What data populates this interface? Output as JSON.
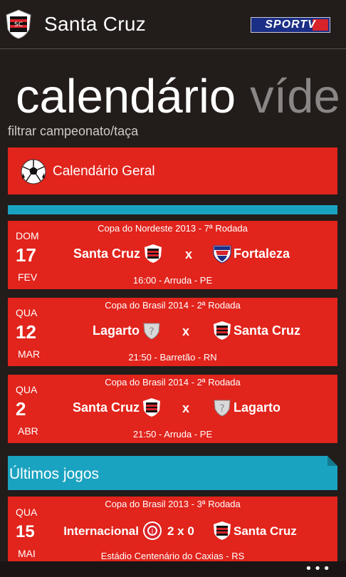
{
  "header": {
    "title": "Santa Cruz",
    "partner_logo_text": "SPORTV"
  },
  "pivot": {
    "active": "calendário",
    "next": "víde"
  },
  "filter_label": "filtrar campeonato/taça",
  "calendar_all": {
    "label": "Calendário Geral",
    "icon": "soccer-ball-icon"
  },
  "upcoming": [
    {
      "competition": "Copa do Nordeste 2013 - 7ª Rodada",
      "weekday": "DOM",
      "day": "17",
      "month": "FEV",
      "home": "Santa Cruz",
      "vs": "x",
      "away": "Fortaleza",
      "venue": "16:00 - Arruda - PE"
    },
    {
      "competition": "Copa do Brasil 2014 - 2ª Rodada",
      "weekday": "QUA",
      "day": "12",
      "month": "MAR",
      "home": "Lagarto",
      "vs": "x",
      "away": "Santa Cruz",
      "venue": "21:50 - Barretão - RN"
    },
    {
      "competition": "Copa do Brasil 2014 - 2ª Rodada",
      "weekday": "QUA",
      "day": "2",
      "month": "ABR",
      "home": "Santa Cruz",
      "vs": "x",
      "away": "Lagarto",
      "venue": "21:50 - Arruda - PE"
    }
  ],
  "last_games_title": "Últimos jogos",
  "last_games": [
    {
      "competition": "Copa do Brasil 2013 - 3ª Rodada",
      "weekday": "QUA",
      "day": "15",
      "month": "MAI",
      "home": "Internacional",
      "score": "2 x 0",
      "away": "Santa Cruz",
      "venue": "Estádio Centenário do Caxias - RS"
    }
  ],
  "appbar": {
    "more_label": "•••"
  },
  "colors": {
    "red_tile": "#e1241c",
    "accent_cyan": "#1aa3c0",
    "background": "#221c1b"
  }
}
